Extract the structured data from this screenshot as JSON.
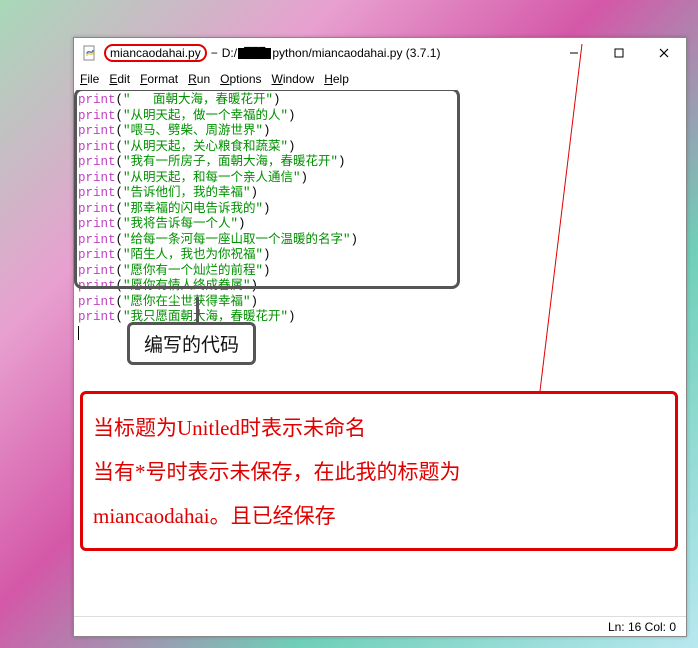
{
  "window": {
    "filename": "miancaodahai.py",
    "path_prefix": "D:/",
    "path_suffix": "python/miancaodahai.py (3.7.1)"
  },
  "menu": {
    "file": "File",
    "edit": "Edit",
    "format": "Format",
    "run": "Run",
    "options": "Options",
    "window": "Window",
    "help": "Help"
  },
  "code": {
    "lines": [
      "\"   面朝大海，春暖花开\"",
      "\"从明天起，做一个幸福的人\"",
      "\"喂马、劈柴、周游世界\"",
      "\"从明天起，关心粮食和蔬菜\"",
      "\"我有一所房子，面朝大海，春暖花开\"",
      "\"从明天起，和每一个亲人通信\"",
      "\"告诉他们，我的幸福\"",
      "\"那幸福的闪电告诉我的\"",
      "\"我将告诉每一个人\"",
      "\"给每一条河每一座山取一个温暖的名字\"",
      "\"陌生人，我也为你祝福\"",
      "\"愿你有一个灿烂的前程\"",
      "\"愿你有情人终成眷属\"",
      "\"愿你在尘世获得幸福\"",
      "\"我只愿面朝大海，春暖花开\""
    ],
    "keyword": "print"
  },
  "status": {
    "text": "Ln: 16   Col: 0"
  },
  "annotations": {
    "code_label": "编写的代码",
    "note_line1": "当标题为Unitled时表示未命名",
    "note_line2": "当有*号时表示未保存，在此我的标题为",
    "note_line3": "miancaodahai。且已经保存"
  }
}
